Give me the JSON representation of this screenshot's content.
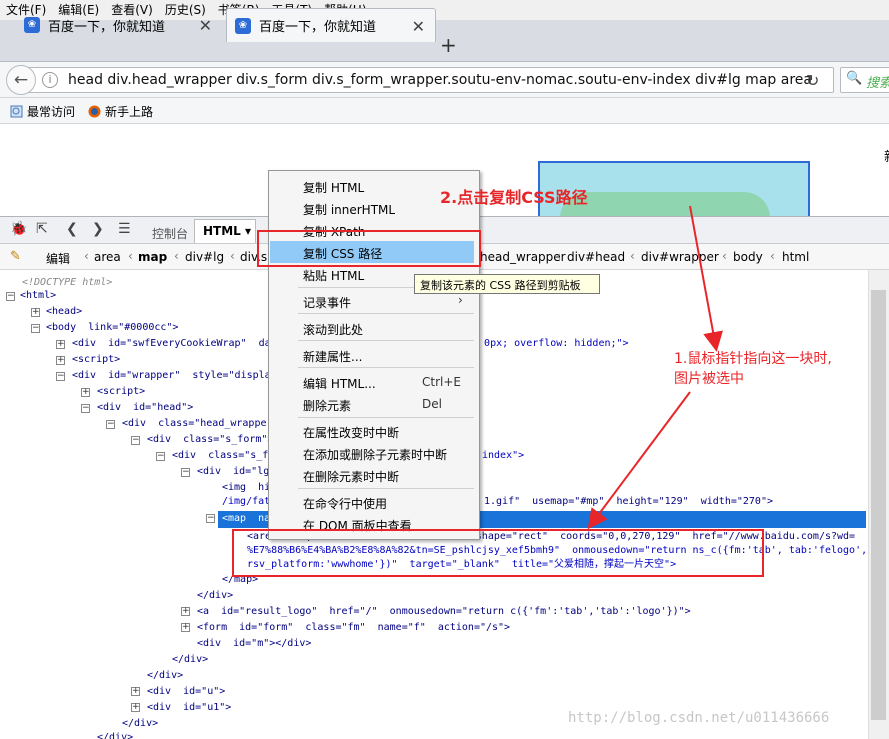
{
  "menu": [
    "文件(F)",
    "编辑(E)",
    "查看(V)",
    "历史(S)",
    "书签(B)",
    "工具(T)",
    "帮助(H)"
  ],
  "tabs": [
    {
      "label": "百度一下，你就知道",
      "active": false
    },
    {
      "label": "百度一下，你就知道",
      "active": true
    }
  ],
  "newtab_label": "+",
  "url": "head div.head_wrapper div.s_form div.s_form_wrapper.soutu-env-nomac.soutu-env-index div#lg map area",
  "search_placeholder": "搜索",
  "bookmarks": [
    "最常访问",
    "新手上路"
  ],
  "page_edge_char": "新",
  "devtools": {
    "console_tab": "控制台",
    "html_tab": "HTML ▾",
    "edit_label": "编辑",
    "crumbs": [
      "area",
      "map",
      "div#lg",
      "div.s",
      "head_wrapper",
      "div#head",
      "div#wrapper",
      "body",
      "html"
    ]
  },
  "tree_lines": [
    "<!DOCTYPE html>",
    "<html>",
    "<head>",
    "<body  link=\"#0000cc\">",
    "<div  id=\"swfEveryCookieWrap\"  data-",
    "t: 0px; overflow: hidden;\">",
    "<script>",
    "<div  id=\"wrapper\"  style=\"display:",
    "<script>",
    "<div  id=\"head\">",
    "<div  class=\"head_wrapper\">",
    "<div  class=\"s_form\">",
    "<div  class=\"s_for",
    "index\">",
    "<div  id=\"lg\">",
    "<img  hid",
    "/img/fath",
    "1.gif\"  usemap=\"#mp\"  height=\"129\"  width=\"270\">",
    "<map  nam",
    "<area  shape  coords  nodecode  true  shape=\"rect\"  coords=\"0,0,270,129\"  href=\"//www.baidu.com/s?wd=",
    "%E7%88%B6%E4%BA%B2%E8%8A%82&tn=SE_pshlcjsy_xef5bmh9\"  onmousedown=\"return ns_c({fm:'tab', tab:'felogo',",
    "rsv_platform:'wwwhome'})\"  target=\"_blank\"  title=\"父爱相随，撑起一片天空\">",
    "</map>",
    "</div>",
    "<a  id=\"result_logo\"  href=\"/\"  onmousedown=\"return c({'fm':'tab','tab':'logo'})\">",
    "<form  id=\"form\"  class=\"fm\"  name=\"f\"  action=\"/s\">",
    "<div  id=\"m\"></div>",
    "</div>",
    "</div>",
    "<div  id=\"u\">",
    "<div  id=\"u1\">",
    "</div>",
    "</div>"
  ],
  "context_menu": {
    "items": [
      "复制 HTML",
      "复制 innerHTML",
      "复制 XPath",
      "复制 CSS 路径",
      "粘贴 HTML",
      "记录事件",
      "滚动到此处",
      "新建属性...",
      "编辑 HTML...",
      "删除元素",
      "在属性改变时中断",
      "在添加或删除子元素时中断",
      "在删除元素时中断",
      "在命令行中使用",
      "在 DOM 面板中查看"
    ],
    "shortcut_edit": "Ctrl+E",
    "shortcut_delete": "Del"
  },
  "tooltip": "复制该元素的 CSS 路径到剪贴板",
  "annotation_step2": "2.点击复制CSS路径",
  "annotation_step1_line1": "1.鼠标指针指向这一块时,",
  "annotation_step1_line2": "图片被选中",
  "watermark": "http://blog.csdn.net/u011436666",
  "colors": {
    "annotation_red": "#e8262a",
    "selection_blue": "#1a73d9",
    "menu_highlight": "#91c9f7"
  }
}
